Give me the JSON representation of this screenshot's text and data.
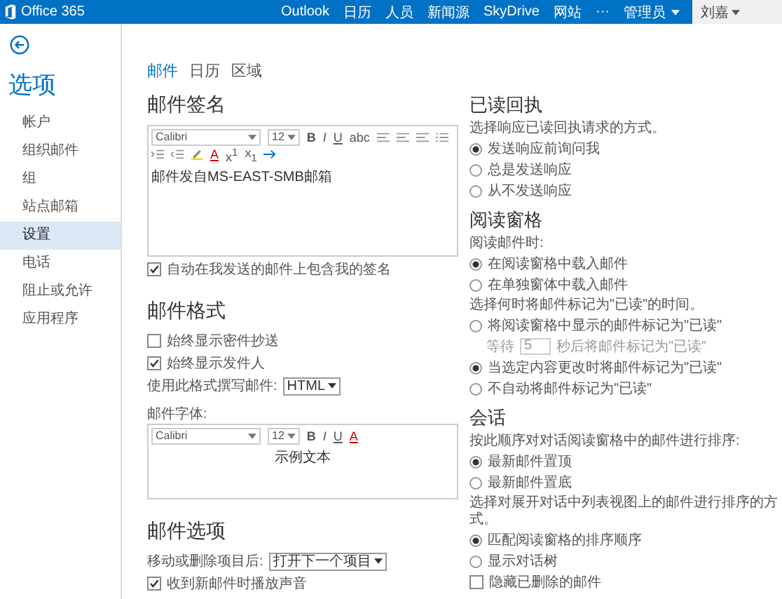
{
  "top_bar": {
    "brand": "Office 365",
    "nav": [
      {
        "label": "Outlook",
        "kind": "link"
      },
      {
        "label": "日历",
        "kind": "link"
      },
      {
        "label": "人员",
        "kind": "link"
      },
      {
        "label": "新闻源",
        "kind": "link"
      },
      {
        "label": "SkyDrive",
        "kind": "link"
      },
      {
        "label": "网站",
        "kind": "link"
      },
      {
        "label": "···",
        "kind": "link"
      },
      {
        "label": "管理员",
        "kind": "menu"
      }
    ],
    "user": "刘嘉"
  },
  "sidebar": {
    "title": "选项",
    "items": [
      {
        "label": "帐户",
        "selected": false
      },
      {
        "label": "组织邮件",
        "selected": false
      },
      {
        "label": "组",
        "selected": false
      },
      {
        "label": "站点邮箱",
        "selected": false
      },
      {
        "label": "设置",
        "selected": true
      },
      {
        "label": "电话",
        "selected": false
      },
      {
        "label": "阻止或允许",
        "selected": false
      },
      {
        "label": "应用程序",
        "selected": false
      }
    ]
  },
  "tabs": [
    {
      "label": "邮件",
      "selected": true
    },
    {
      "label": "日历",
      "selected": false
    },
    {
      "label": "区域",
      "selected": false
    }
  ],
  "signature": {
    "title": "邮件签名",
    "font": "Calibri",
    "size": "12",
    "format_buttons": [
      "B",
      "I",
      "U",
      "abc"
    ],
    "script_buttons": [
      "A",
      "x$^{1}$",
      "x$_{1}$"
    ],
    "text": "邮件发自MS-EAST-SMB邮箱",
    "options": [
      {
        "label": "自动在我发送的邮件上包含我的签名",
        "checked": true
      }
    ]
  },
  "format": {
    "title": "邮件格式",
    "options": [
      {
        "label": "始终显示密件抄送",
        "checked": false
      },
      {
        "label": "始终显示发件人",
        "checked": true
      }
    ],
    "compose_label": "使用此格式撰写邮件:",
    "compose_value": "HTML",
    "font_label": "邮件字体:",
    "font": "Calibri",
    "size": "12",
    "format_buttons": [
      "B",
      "I",
      "U",
      "A"
    ],
    "sample": "示例文本"
  },
  "message_options": {
    "title": "邮件选项",
    "after_move_label": "移动或删除项目后:",
    "after_move_value": "打开下一个项目",
    "options": [
      {
        "label": "收到新邮件时播放声音",
        "checked": true
      }
    ]
  },
  "read_receipts": {
    "title": "已读回执",
    "groups": [
      {
        "prompt": "选择响应已读回执请求的方式。",
        "items": [
          {
            "kind": "radio",
            "label": "发送响应前询问我",
            "selected": true
          },
          {
            "kind": "radio",
            "label": "总是发送响应",
            "selected": false
          },
          {
            "kind": "radio",
            "label": "从不发送响应",
            "selected": false
          }
        ]
      }
    ]
  },
  "reading_pane": {
    "title": "阅读窗格",
    "groups": [
      {
        "prompt": "阅读邮件时:",
        "items": [
          {
            "kind": "radio",
            "label": "在阅读窗格中载入邮件",
            "selected": true
          },
          {
            "kind": "radio",
            "label": "在单独窗体中载入邮件",
            "selected": false
          }
        ]
      },
      {
        "prompt": "选择何时将邮件标记为\"已读\"的时间。",
        "items": [
          {
            "kind": "radio",
            "label": "将阅读窗格中显示的邮件标记为\"已读\"",
            "selected": false
          },
          {
            "kind": "delay",
            "before": "等待",
            "value": "5",
            "after": "秒后将邮件标记为\"已读\""
          },
          {
            "kind": "radio",
            "label": "当选定内容更改时将邮件标记为\"已读\"",
            "selected": true
          },
          {
            "kind": "radio",
            "label": "不自动将邮件标记为\"已读\"",
            "selected": false
          }
        ]
      }
    ]
  },
  "conversations": {
    "title": "会话",
    "groups": [
      {
        "prompt": "按此顺序对对话阅读窗格中的邮件进行排序:",
        "items": [
          {
            "kind": "radio",
            "label": "最新邮件置顶",
            "selected": true
          },
          {
            "kind": "radio",
            "label": "最新邮件置底",
            "selected": false
          }
        ]
      },
      {
        "prompt": "选择对展开对话中列表视图上的邮件进行排序的方式。",
        "items": [
          {
            "kind": "radio",
            "label": "匹配阅读窗格的排序顺序",
            "selected": true
          },
          {
            "kind": "radio",
            "label": "显示对话树",
            "selected": false
          }
        ]
      }
    ],
    "options": [
      {
        "label": "隐藏已删除的邮件",
        "checked": false
      }
    ]
  }
}
